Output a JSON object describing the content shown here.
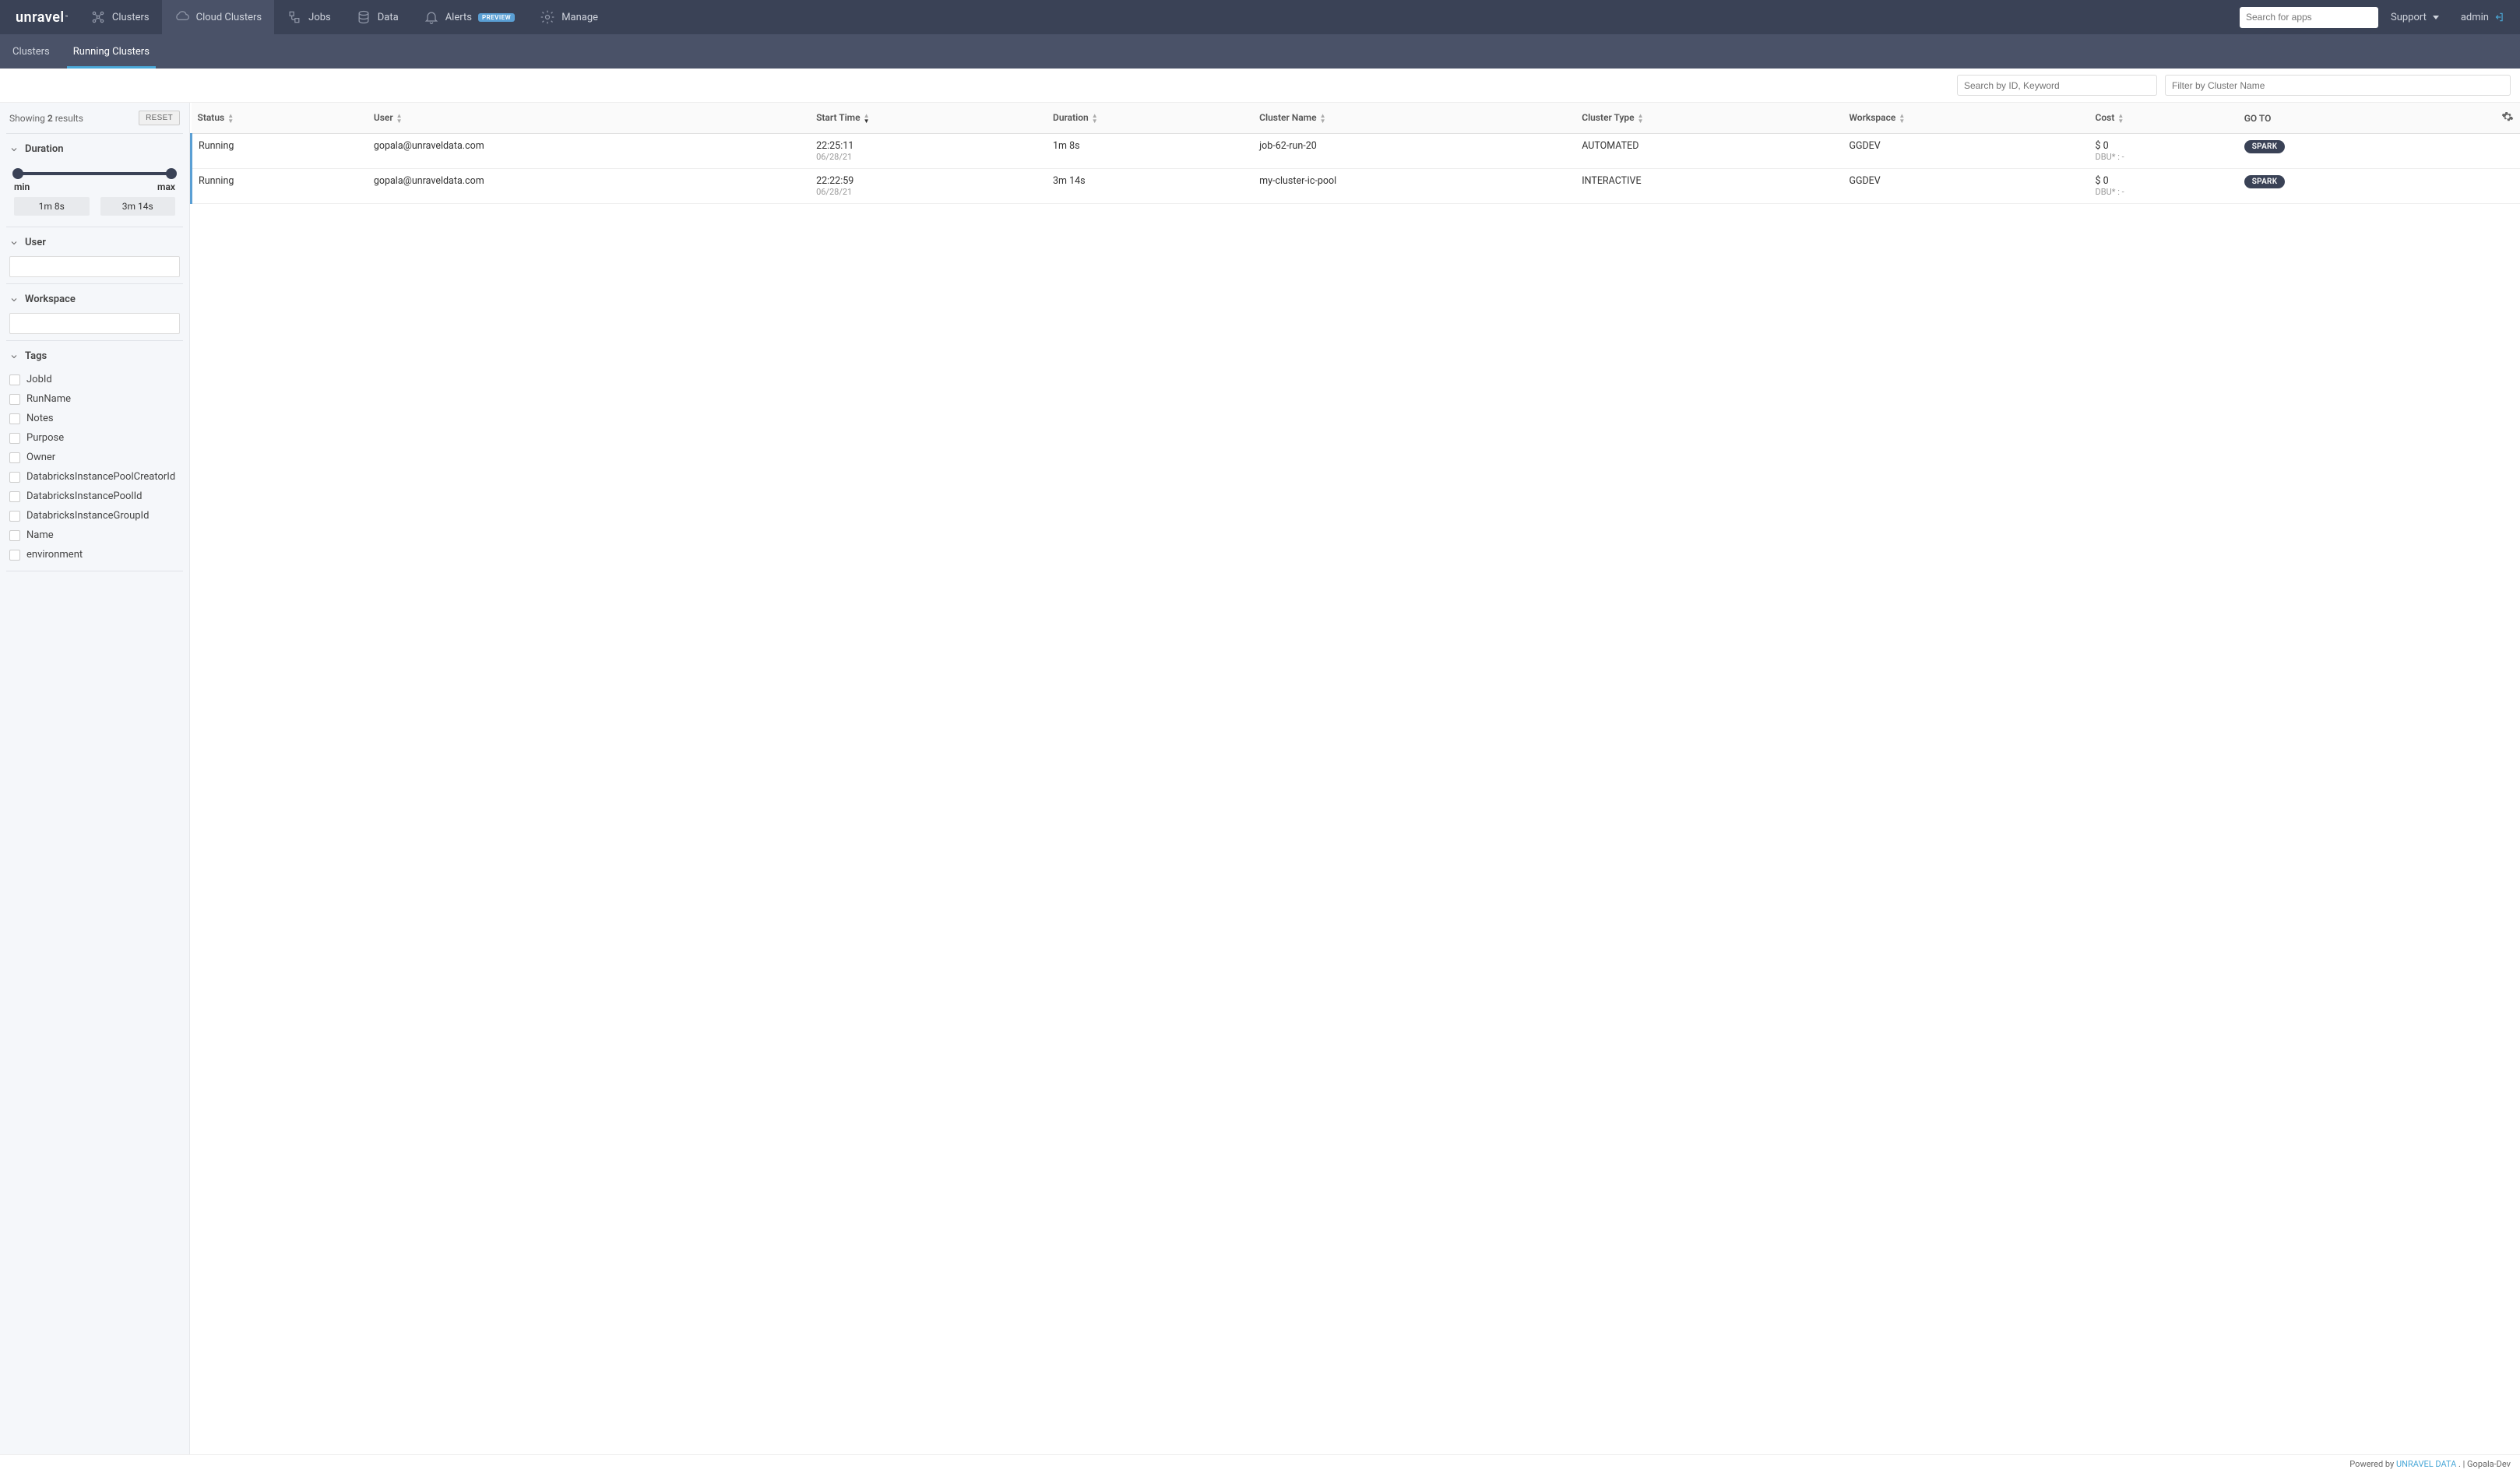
{
  "brand": "unravel",
  "topnav": {
    "items": [
      {
        "label": "Clusters",
        "name": "nav-clusters"
      },
      {
        "label": "Cloud Clusters",
        "name": "nav-cloud-clusters",
        "active": true
      },
      {
        "label": "Jobs",
        "name": "nav-jobs"
      },
      {
        "label": "Data",
        "name": "nav-data"
      },
      {
        "label": "Alerts",
        "name": "nav-alerts",
        "badge": "PREVIEW"
      },
      {
        "label": "Manage",
        "name": "nav-manage"
      }
    ],
    "search_placeholder": "Search for apps",
    "support": "Support",
    "user": "admin"
  },
  "subnav": {
    "items": [
      {
        "label": "Clusters",
        "name": "subtab-clusters"
      },
      {
        "label": "Running Clusters",
        "name": "subtab-running",
        "active": true
      }
    ]
  },
  "filters": {
    "search_placeholder": "Search by ID, Keyword",
    "filter_placeholder": "Filter by Cluster Name"
  },
  "sidebar": {
    "showing_prefix": "Showing ",
    "showing_count": "2",
    "showing_suffix": " results",
    "reset": "RESET",
    "duration": {
      "title": "Duration",
      "min_label": "min",
      "max_label": "max",
      "min_value": "1m 8s",
      "max_value": "3m 14s"
    },
    "user": {
      "title": "User"
    },
    "workspace": {
      "title": "Workspace"
    },
    "tags": {
      "title": "Tags",
      "items": [
        "JobId",
        "RunName",
        "Notes",
        "Purpose",
        "Owner",
        "DatabricksInstancePoolCreatorId",
        "DatabricksInstancePoolId",
        "DatabricksInstanceGroupId",
        "Name",
        "environment"
      ]
    }
  },
  "table": {
    "headers": {
      "status": "Status",
      "user": "User",
      "start": "Start Time",
      "duration": "Duration",
      "cluster_name": "Cluster Name",
      "cluster_type": "Cluster Type",
      "workspace": "Workspace",
      "cost": "Cost",
      "goto": "GO TO"
    },
    "rows": [
      {
        "status": "Running",
        "user": "gopala@unraveldata.com",
        "start_time": "22:25:11",
        "start_date": "06/28/21",
        "duration": "1m 8s",
        "cluster_name": "job-62-run-20",
        "cluster_type": "AUTOMATED",
        "workspace": "GGDEV",
        "cost": "$ 0",
        "cost_sub": "DBU* : -",
        "goto": "SPARK"
      },
      {
        "status": "Running",
        "user": "gopala@unraveldata.com",
        "start_time": "22:22:59",
        "start_date": "06/28/21",
        "duration": "3m 14s",
        "cluster_name": "my-cluster-ic-pool",
        "cluster_type": "INTERACTIVE",
        "workspace": "GGDEV",
        "cost": "$ 0",
        "cost_sub": "DBU* : -",
        "goto": "SPARK"
      }
    ]
  },
  "footer": {
    "powered": "Powered by ",
    "link": "UNRAVEL DATA",
    "suffix": " . | Gopala-Dev"
  }
}
